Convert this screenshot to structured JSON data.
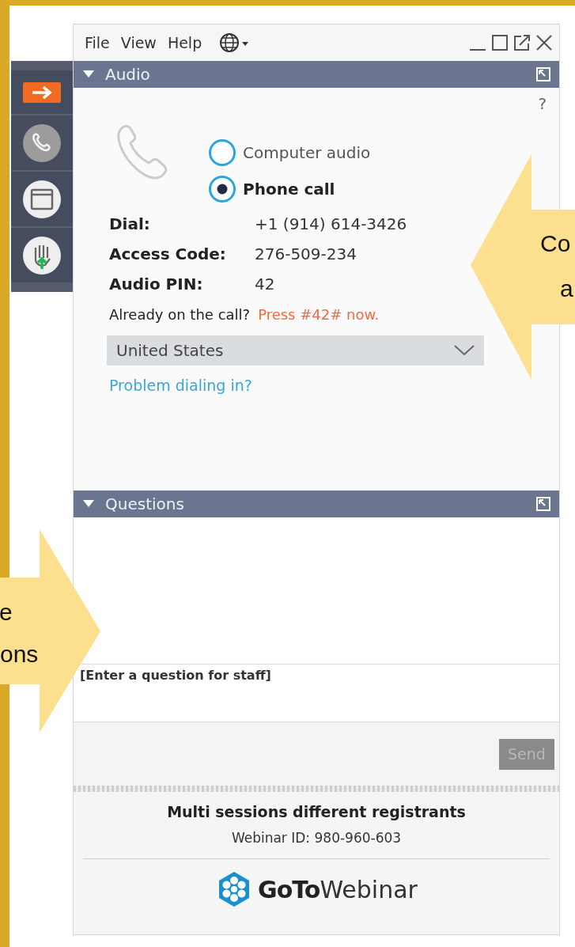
{
  "menu": [
    "File",
    "View",
    "Help"
  ],
  "toolbar": [
    {
      "kind": "exit"
    },
    {
      "kind": "phone"
    },
    {
      "kind": "screen"
    },
    {
      "kind": "hand"
    }
  ],
  "audio": {
    "title": "Audio",
    "expanded": true,
    "help": "?",
    "options": [
      {
        "label": "Computer audio",
        "selected": false
      },
      {
        "label": "Phone call",
        "selected": true
      }
    ],
    "details": [
      {
        "label": "Dial:",
        "value": "+1 (914) 614-3426"
      },
      {
        "label": "Access Code:",
        "value": "276-509-234"
      },
      {
        "label": "Audio PIN:",
        "value": "42"
      }
    ],
    "already": "Already on the call?",
    "press": "Press #42# now.",
    "country": "United States",
    "problem_link": "Problem dialing in?"
  },
  "questions": {
    "title": "Questions",
    "expanded": true,
    "placeholder": "[Enter a question for staff]",
    "send": "Send",
    "send_disabled": true
  },
  "footer": {
    "session": "Multi sessions different registrants",
    "webinar_id": "Webinar ID: 980-960-603",
    "logo_bold": "GoTo",
    "logo_light": "Webinar"
  },
  "callouts": [
    {
      "kind": "pointing_left",
      "lines": [
        "Co",
        "a"
      ]
    },
    {
      "kind": "pointing_right",
      "lines": [
        "e",
        "ons"
      ]
    }
  ]
}
